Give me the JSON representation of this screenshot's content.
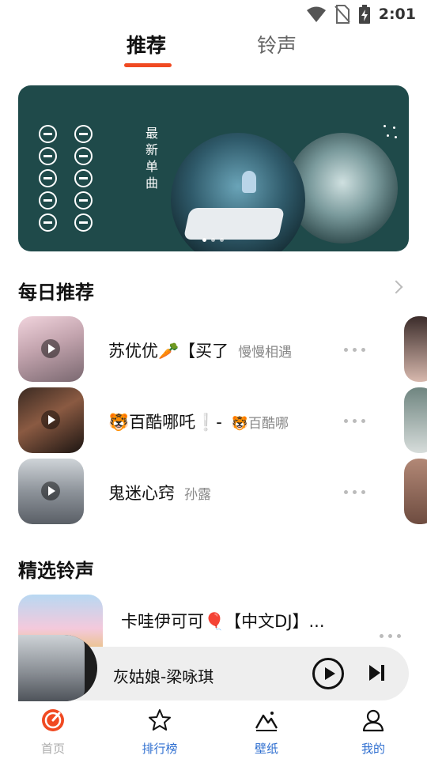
{
  "status_bar": {
    "time": "2:01"
  },
  "top_tabs": [
    {
      "label": "推荐",
      "active": true
    },
    {
      "label": "铃声",
      "active": false
    }
  ],
  "banner": {
    "vertical_text": "最新单曲",
    "dots": 3,
    "active_dot": 0
  },
  "daily": {
    "title": "每日推荐",
    "songs": [
      {
        "title": "苏优优🥕【买了",
        "artist": "慢慢相遇"
      },
      {
        "title": "🐯百酷哪吒❕-",
        "artist": "🐯百酷哪"
      },
      {
        "title": "鬼迷心窍",
        "artist": "孙露"
      }
    ]
  },
  "ringtones": {
    "title": "精选铃声",
    "items": [
      {
        "title": "卡哇伊可可🎈【中文DJ】..."
      }
    ]
  },
  "player": {
    "now_playing": "灰姑娘-梁咏琪"
  },
  "bottom_nav": [
    {
      "label": "首页",
      "icon": "music-disc-icon"
    },
    {
      "label": "排行榜",
      "icon": "star-icon"
    },
    {
      "label": "壁纸",
      "icon": "mountain-icon"
    },
    {
      "label": "我的",
      "icon": "person-icon"
    }
  ],
  "colors": {
    "accent": "#f04a22",
    "nav_active": "#2f6fd0",
    "banner_bg": "#1f4a4a"
  }
}
